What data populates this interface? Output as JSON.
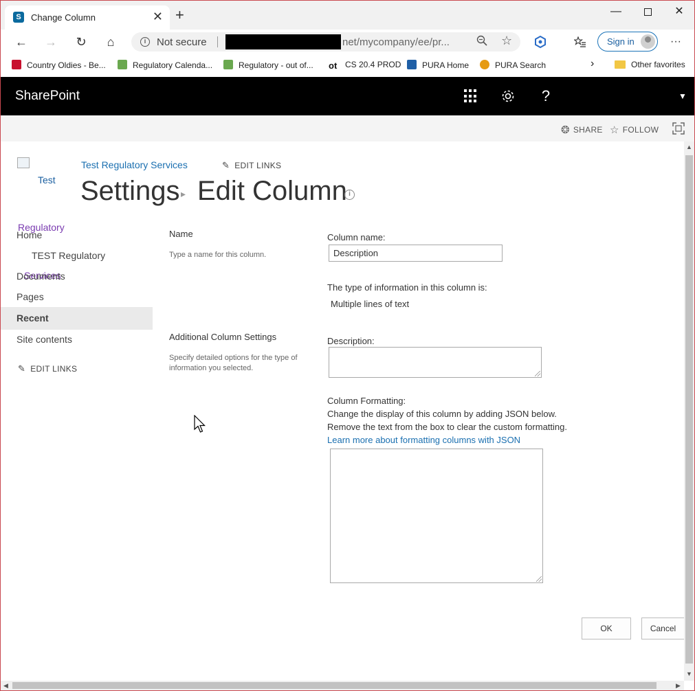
{
  "browser": {
    "tab_title": "Change Column",
    "tab_favicon": "S",
    "address": {
      "security": "Not secure",
      "url_visible": "net/mycompany/ee/pr..."
    },
    "sign_in": "Sign in",
    "favorites": [
      {
        "label": "Country Oldies - Be...",
        "color": "#c8102e"
      },
      {
        "label": "Regulatory Calenda...",
        "color": "#6aa84f"
      },
      {
        "label": "Regulatory - out of...",
        "color": "#6aa84f"
      },
      {
        "label": "CS 20.4 PROD",
        "color": "#111111"
      },
      {
        "label": "PURA Home",
        "color": "#1f5fa6"
      },
      {
        "label": "PURA Search",
        "color": "#e69b12"
      }
    ],
    "other_favorites": "Other favorites"
  },
  "suite": {
    "brand": "SharePoint",
    "help": "?"
  },
  "share_bar": {
    "share": "SHARE",
    "follow": "FOLLOW"
  },
  "site": {
    "logo_alt": "Test",
    "breadcrumb_site": "Test Regulatory Services",
    "edit_links": "EDIT LINKS",
    "title_part1": "Settings",
    "title_part2": "Edit Column"
  },
  "left_nav": {
    "overlap_logo_word": "Regulatory",
    "home": "Home",
    "test_regulatory": "TEST Regulatory",
    "overlap_services": "Services",
    "documents": "Documents",
    "pages": "Pages",
    "recent": "Recent",
    "site_contents": "Site contents",
    "edit_links": "EDIT LINKS"
  },
  "form": {
    "name_section": {
      "label": "Name",
      "description": "Type a name for this column."
    },
    "column_name_label": "Column name:",
    "column_name_value": "Description",
    "type_label": "The type of information in this column is:",
    "type_value": "Multiple lines of text",
    "additional_section": {
      "label": "Additional Column Settings",
      "description": "Specify detailed options for the type of information you selected."
    },
    "description_label": "Description:",
    "formatting_label": "Column Formatting:",
    "formatting_help_1": "Change the display of this column by adding JSON below.",
    "formatting_help_2": "Remove the text from the box to clear the custom formatting.",
    "formatting_link": "Learn more about formatting columns with JSON",
    "ok": "OK",
    "cancel": "Cancel"
  }
}
